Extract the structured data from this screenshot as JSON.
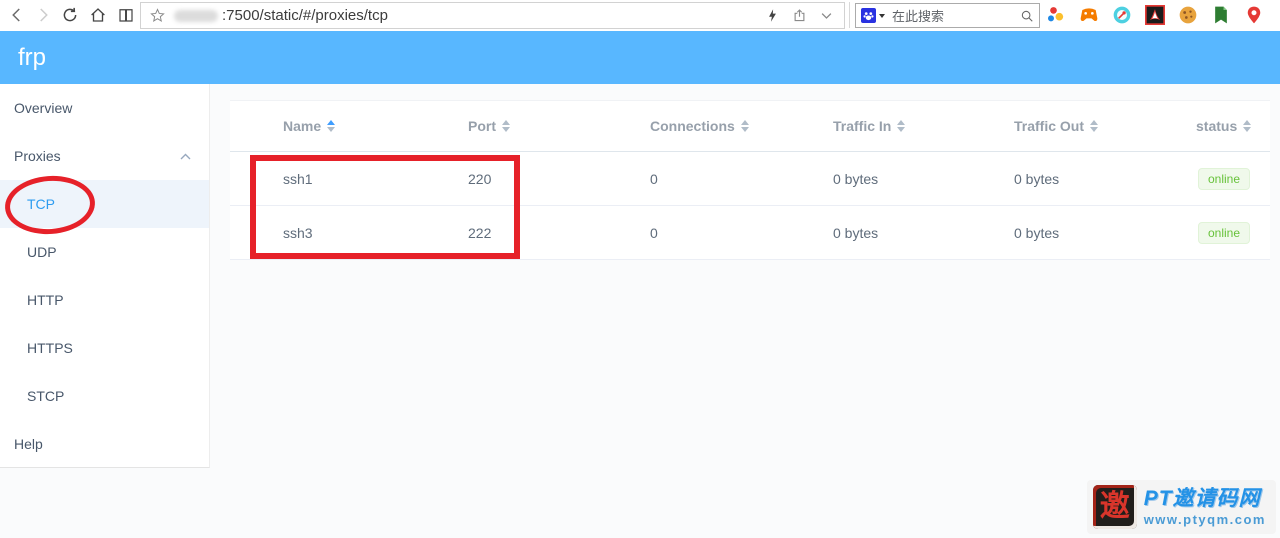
{
  "browser": {
    "url": ":7500/static/#/proxies/tcp",
    "search_placeholder": "在此搜索",
    "nav_icons": [
      "back-icon",
      "forward-icon",
      "refresh-icon",
      "home-icon",
      "reading-list-icon"
    ],
    "addressbar_icons": [
      "favorite-star-icon",
      "flash-icon",
      "share-icon",
      "chevron-down-icon"
    ],
    "extension_icons": [
      "molecule-icon",
      "game-controller-icon",
      "compass-icon",
      "acrobat-icon",
      "cookie-icon",
      "green-bookmark-icon",
      "map-pin-icon"
    ]
  },
  "header": {
    "app_title": "frp",
    "accent_color": "#58b7ff"
  },
  "sidebar": {
    "items": [
      {
        "label": "Overview"
      },
      {
        "label": "Proxies",
        "expanded": true
      },
      {
        "label": "Help"
      }
    ],
    "proxy_types": [
      {
        "label": "TCP",
        "active": true
      },
      {
        "label": "UDP"
      },
      {
        "label": "HTTP"
      },
      {
        "label": "HTTPS"
      },
      {
        "label": "STCP"
      }
    ],
    "active_color": "#2d9cf0"
  },
  "table": {
    "columns": [
      {
        "label": "Name",
        "sort": "ascending"
      },
      {
        "label": "Port",
        "sort": "none"
      },
      {
        "label": "Connections",
        "sort": "none"
      },
      {
        "label": "Traffic In",
        "sort": "none"
      },
      {
        "label": "Traffic Out",
        "sort": "none"
      },
      {
        "label": "status",
        "sort": "none"
      }
    ],
    "rows": [
      {
        "name": "ssh1",
        "port": "220",
        "connections": "0",
        "traffic_in": "0 bytes",
        "traffic_out": "0 bytes",
        "status": "online"
      },
      {
        "name": "ssh3",
        "port": "222",
        "connections": "0",
        "traffic_in": "0 bytes",
        "traffic_out": "0 bytes",
        "status": "online"
      }
    ],
    "status_badge": {
      "bg": "#f0f9eb",
      "text_color": "#67c23a"
    }
  },
  "annotations": {
    "highlight_color": "#e62129",
    "circled_item": "TCP",
    "boxed_cells": [
      "ssh1",
      "220",
      "ssh3",
      "222"
    ]
  },
  "watermark": {
    "seal_char": "邀",
    "site_name": "PT邀请码网",
    "site_url": "www.ptyqm.com"
  }
}
